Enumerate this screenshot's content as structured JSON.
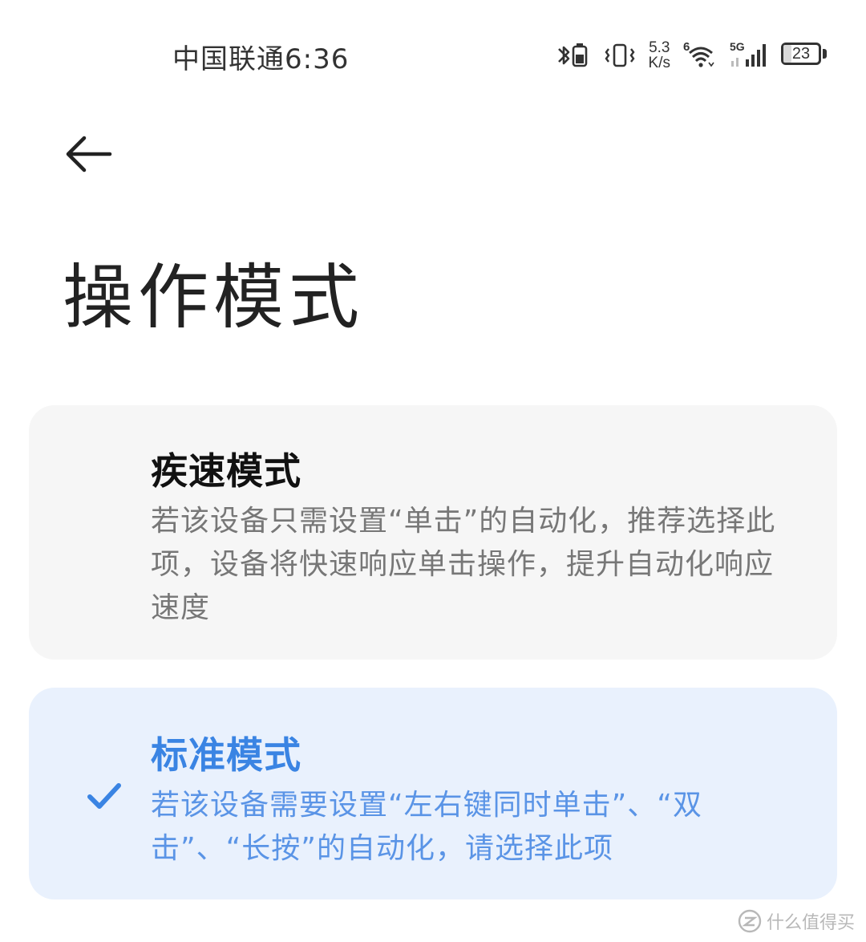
{
  "status_bar": {
    "carrier": "中国联通",
    "time": "6:36",
    "net_speed_value": "5.3",
    "net_speed_unit": "K/s",
    "wifi_badge": "6",
    "cell_badge": "5G",
    "battery_level": "23",
    "icons": [
      "bluetooth-icon",
      "vibrate-icon",
      "wifi-icon",
      "signal-icon",
      "battery-icon"
    ]
  },
  "header": {
    "back_icon": "back-arrow-icon",
    "title": "操作模式"
  },
  "options": [
    {
      "title": "疾速模式",
      "description": "若该设备只需设置“单击”的自动化，推荐选择此项，设备将快速响应单击操作，提升自动化响应速度",
      "selected": false
    },
    {
      "title": "标准模式",
      "description": "若该设备需要设置“左右键同时单击”、“双击”、“长按”的自动化，请选择此项",
      "selected": true
    }
  ],
  "colors": {
    "accent": "#3a84e3",
    "selected_card_bg": "#e9f1fd",
    "card_bg": "#f6f6f6",
    "title_text": "#222222",
    "secondary_text": "#777777"
  },
  "watermark": {
    "text": "什么值得买",
    "icon": "zhi-logo-icon"
  }
}
